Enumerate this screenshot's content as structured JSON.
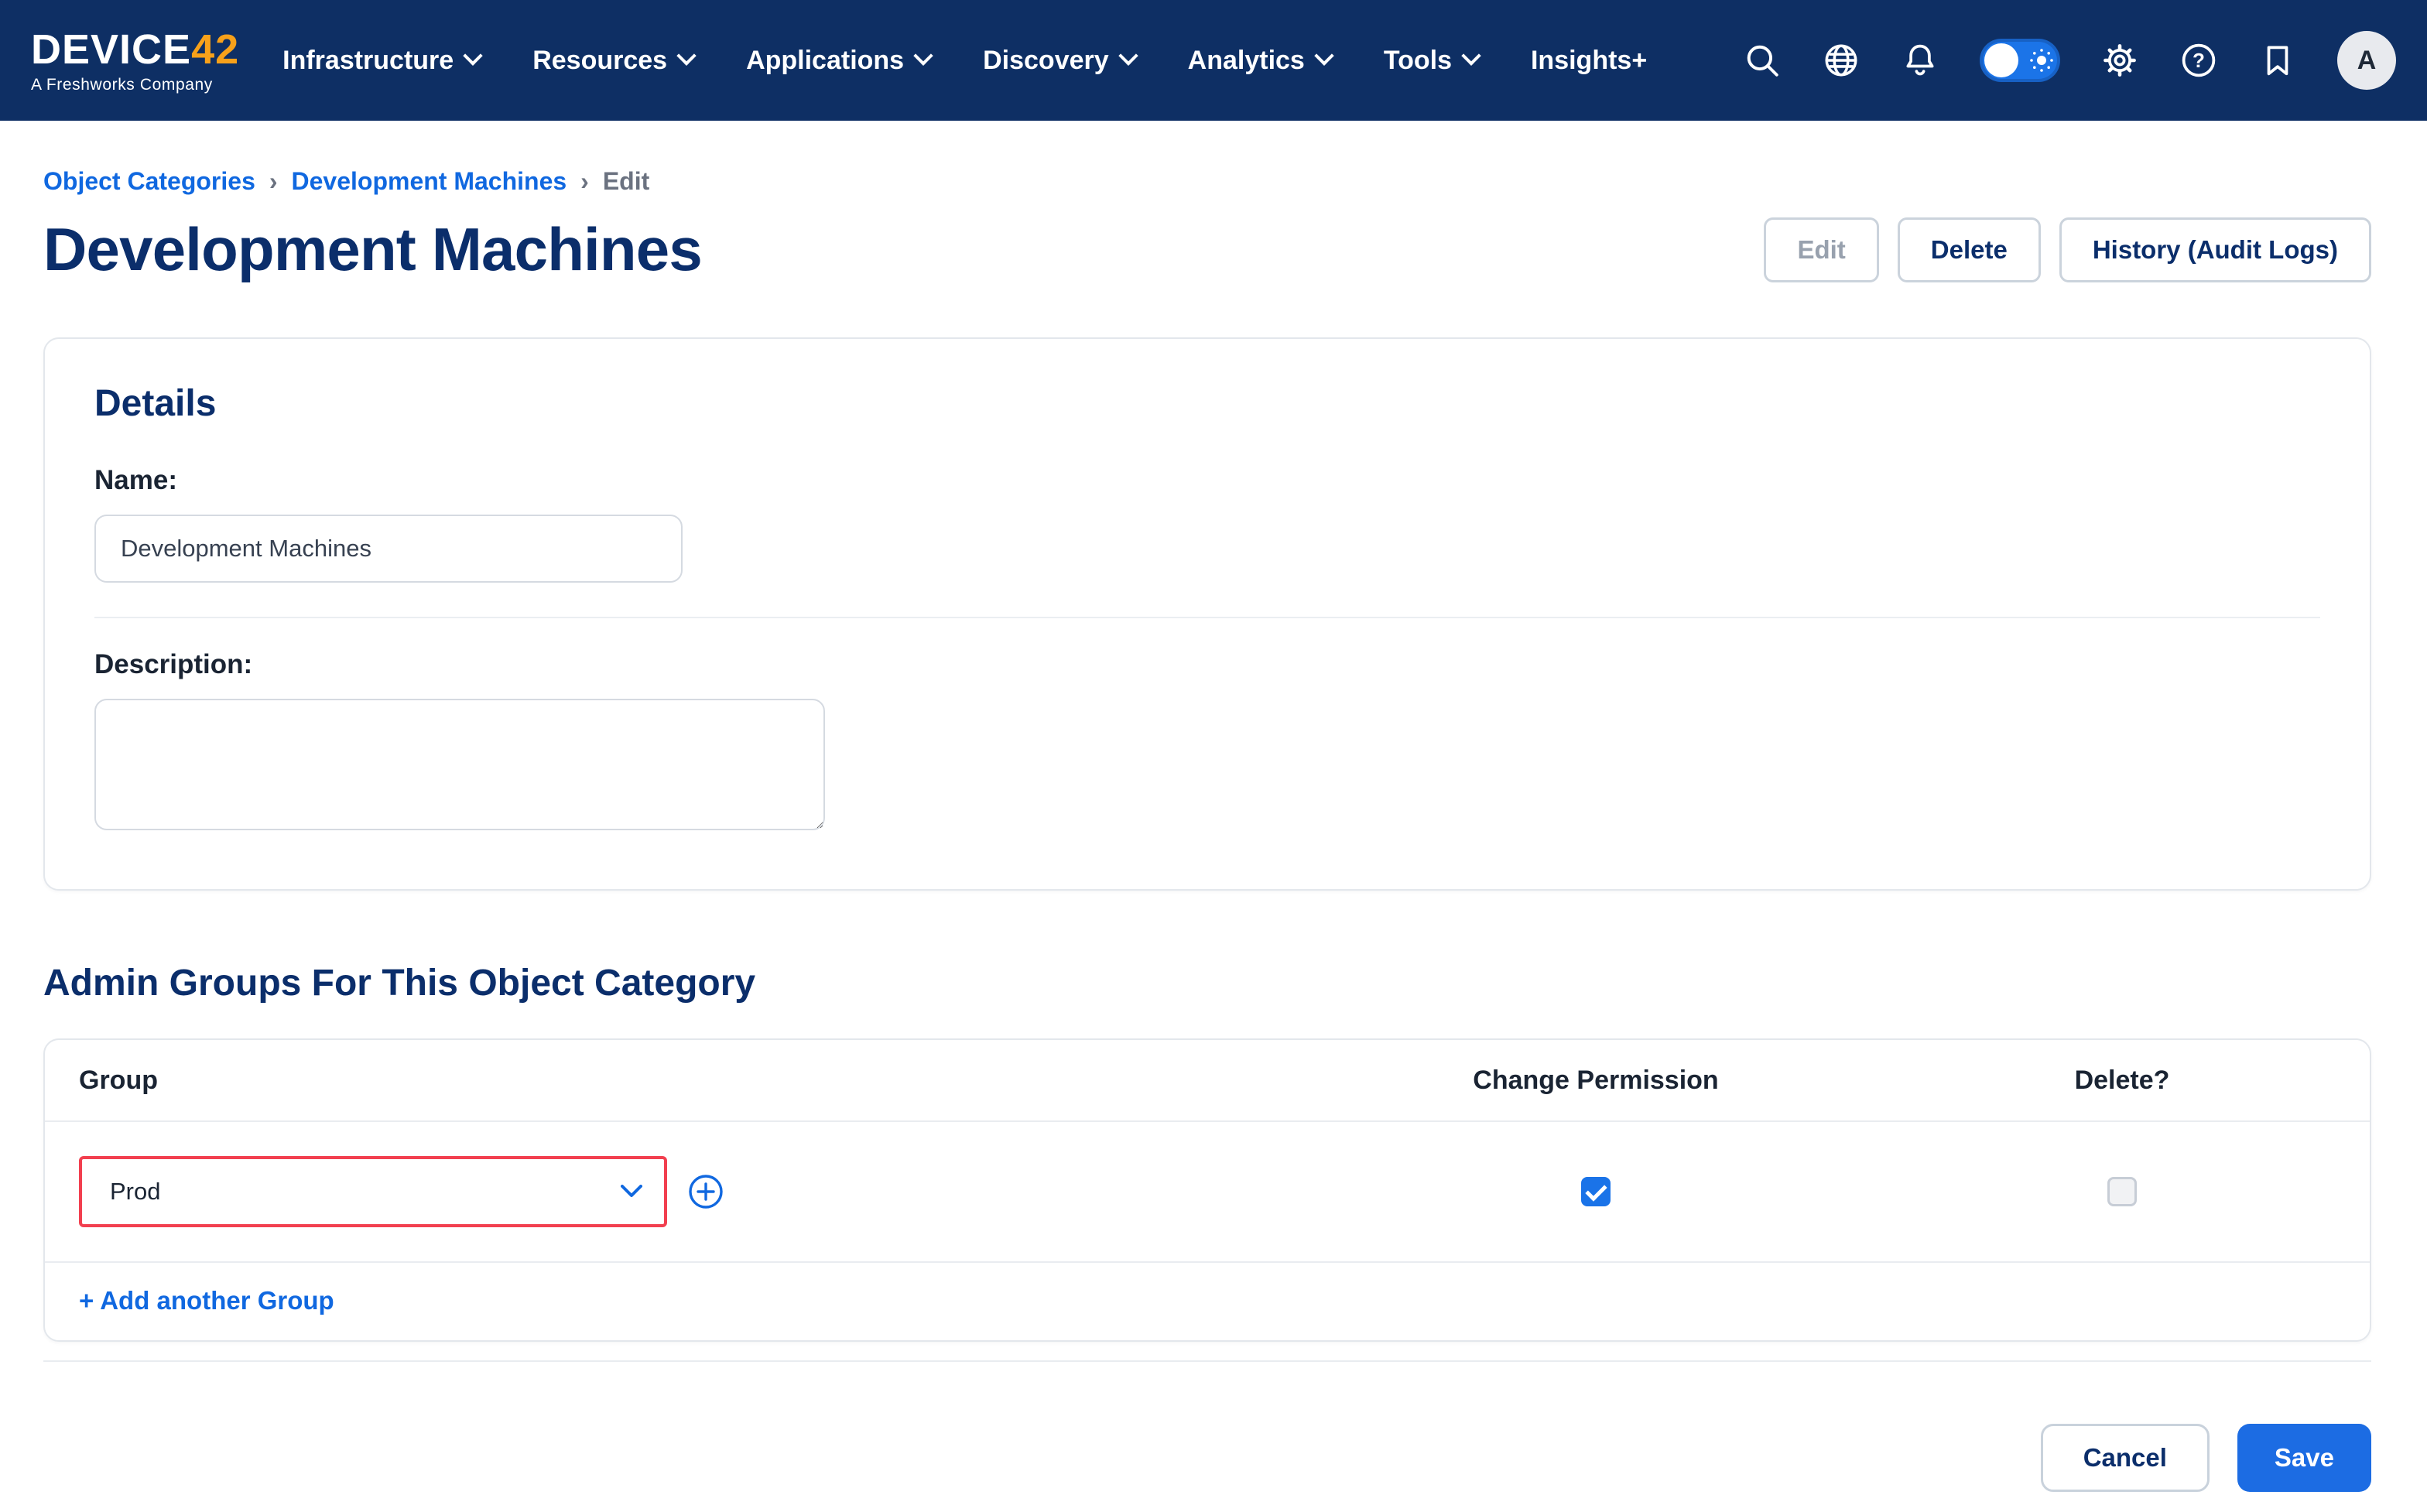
{
  "nav": {
    "brand": {
      "name_primary": "DEVICE",
      "name_accent": "42",
      "tagline": "A Freshworks Company"
    },
    "items": [
      {
        "label": "Infrastructure"
      },
      {
        "label": "Resources"
      },
      {
        "label": "Applications"
      },
      {
        "label": "Discovery"
      },
      {
        "label": "Analytics"
      },
      {
        "label": "Tools"
      },
      {
        "label": "Insights+"
      }
    ],
    "help_glyph": "?",
    "avatar_initial": "A"
  },
  "breadcrumb": {
    "separator": "›",
    "items": [
      {
        "label": "Object Categories"
      },
      {
        "label": "Development Machines"
      },
      {
        "label": "Edit"
      }
    ]
  },
  "page": {
    "title": "Development Machines",
    "actions": {
      "edit": "Edit",
      "delete": "Delete",
      "history": "History (Audit Logs)"
    }
  },
  "details": {
    "heading": "Details",
    "name_label": "Name:",
    "name_value": "Development Machines",
    "description_label": "Description:",
    "description_value": ""
  },
  "admin_groups": {
    "heading": "Admin Groups For This Object Category",
    "columns": [
      "Group",
      "Change Permission",
      "Delete?"
    ],
    "rows": [
      {
        "group": "Prod",
        "change_permission": true,
        "delete": false
      }
    ],
    "add_label": "+ Add another Group"
  },
  "footer": {
    "cancel": "Cancel",
    "save": "Save"
  },
  "colors": {
    "nav_bg": "#0E2F64",
    "title_navy": "#0B2E6B",
    "link_blue": "#1068E0",
    "save_blue": "#1C6CE3",
    "checkbox_blue": "#1A73E8",
    "highlight_red": "#F23F4F",
    "brand_orange": "#F7A11A"
  }
}
